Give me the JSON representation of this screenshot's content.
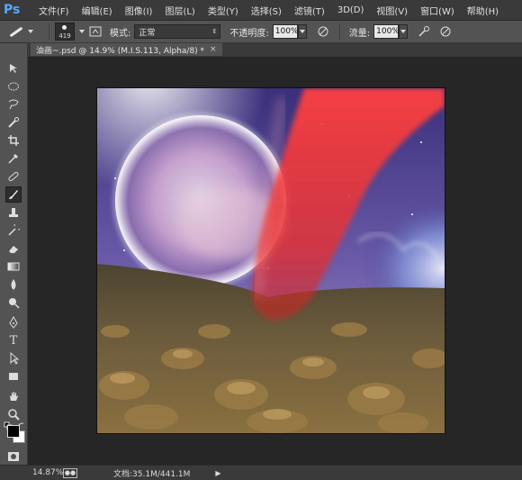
{
  "app": {
    "logo": "Ps"
  },
  "menu": [
    "文件(F)",
    "编辑(E)",
    "图像(I)",
    "图层(L)",
    "类型(Y)",
    "选择(S)",
    "滤镜(T)",
    "3D(D)",
    "视图(V)",
    "窗口(W)",
    "帮助(H)"
  ],
  "options": {
    "brush_size": "419",
    "mode_label": "模式:",
    "mode_value": "正常",
    "opacity_label": "不透明度:",
    "opacity_value": "100%",
    "flow_label": "流量:",
    "flow_value": "100%"
  },
  "document": {
    "tab_title": "油画~.psd @ 14.9% (M.I.S.113, Alpha/8) *",
    "close_glyph": "×"
  },
  "status": {
    "zoom": "14.87%",
    "doc_info": "文档:35.1M/441.1M",
    "arrow": "▶"
  },
  "icons": {
    "toolbox": [
      "move-icon",
      "marquee-icon",
      "lasso-icon",
      "quick-select-icon",
      "crop-icon",
      "eyedropper-icon",
      "healing-icon",
      "brush-icon",
      "stamp-icon",
      "history-brush-icon",
      "eraser-icon",
      "gradient-icon",
      "blur-icon",
      "dodge-icon",
      "pen-icon",
      "type-icon",
      "path-select-icon",
      "shape-icon",
      "hand-icon",
      "zoom-icon"
    ]
  },
  "colors": {
    "foreground": "#000000",
    "background": "#ffffff",
    "accent": "#5aa7ff"
  }
}
